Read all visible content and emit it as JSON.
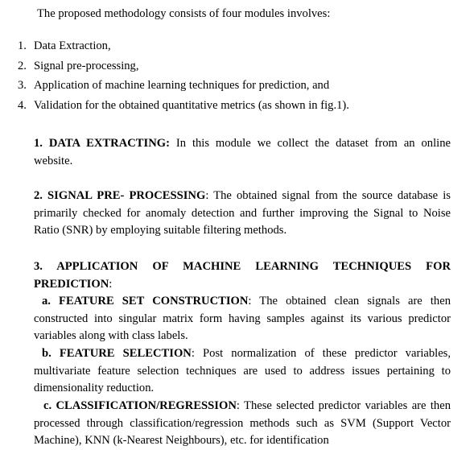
{
  "intro": "The proposed methodology consists of four modules involves:",
  "modules": [
    {
      "num": "1.",
      "text": "Data Extraction,"
    },
    {
      "num": "2.",
      "text": "Signal pre-processing,"
    },
    {
      "num": "3.",
      "text": "Application of machine learning techniques for prediction, and"
    },
    {
      "num": "4.",
      "text": "Validation for the obtained quantitative metrics (as shown in fig.1)."
    }
  ],
  "sections": {
    "data_extracting": {
      "heading": "1. DATA EXTRACTING:",
      "body": " In this module we collect the dataset from an online website."
    },
    "signal_preprocessing": {
      "heading": "2. SIGNAL PRE- PROCESSING",
      "body": ": The obtained signal from the source database is primarily checked for anomaly detection and further improving the Signal to Noise Ratio (SNR) by employing suitable filtering methods."
    },
    "ml_techniques": {
      "heading": "3. APPLICATION OF MACHINE LEARNING TECHNIQUES FOR PREDICTION",
      "heading_suffix": ":",
      "a_heading": "a. FEATURE SET CONSTRUCTION",
      "a_body": ": The obtained clean signals are then constructed into singular matrix form having samples against its various predictor variables along with class labels.",
      "b_heading": "b. FEATURE SELECTION",
      "b_body": ": Post normalization of these predictor variables, multivariate feature selection techniques are used to address issues pertaining to dimensionality reduction.",
      "c_heading": "c. CLASSIFICATION/REGRESSION",
      "c_body": ": These selected predictor variables are then processed through classification/regression methods such as SVM (Support Vector Machine), KNN (k-Nearest Neighbours), etc. for identification"
    }
  }
}
